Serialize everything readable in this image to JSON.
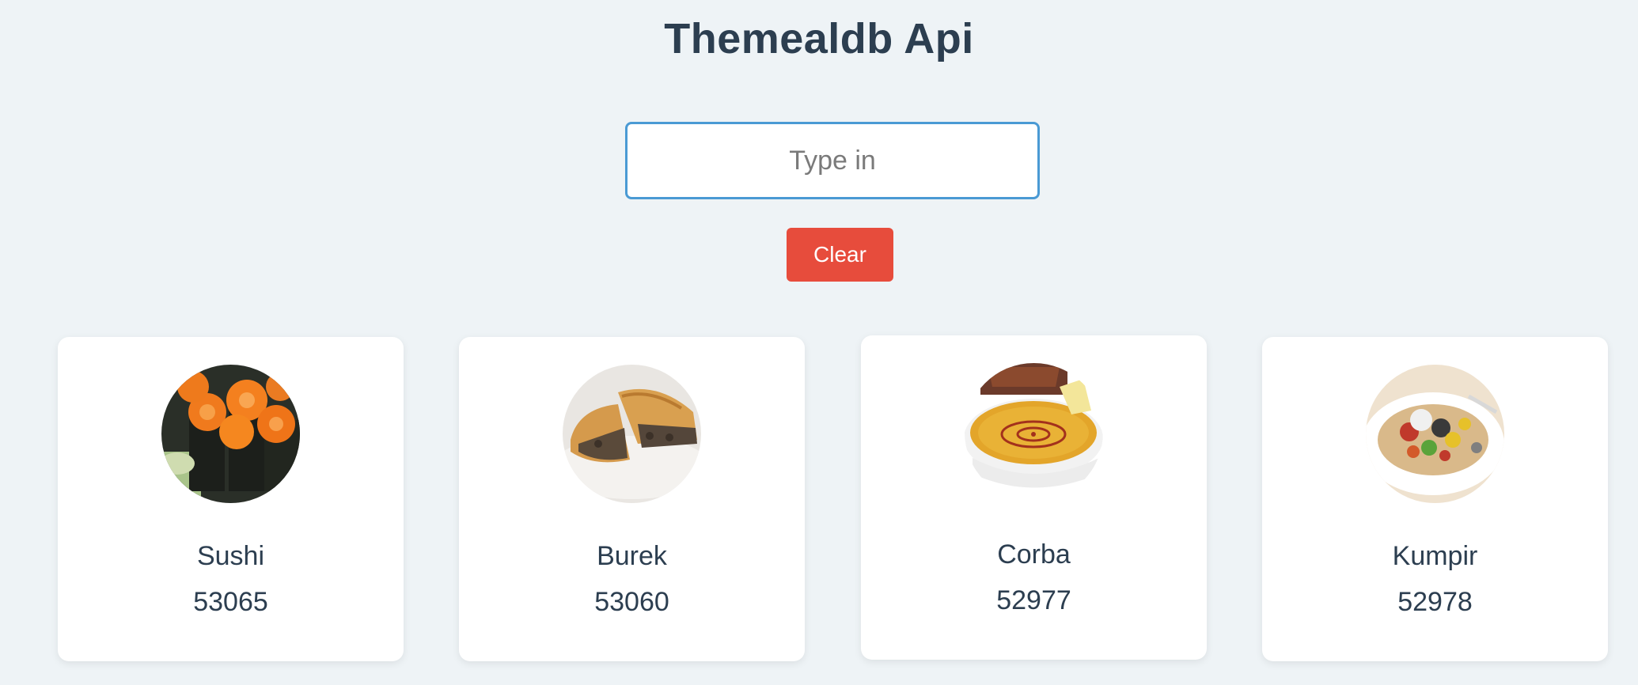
{
  "header": {
    "title": "Themealdb Api"
  },
  "search": {
    "placeholder": "Type in",
    "value": ""
  },
  "clear_button": {
    "label": "Clear"
  },
  "meals": [
    {
      "name": "Sushi",
      "id": "53065",
      "image": "sushi-photo"
    },
    {
      "name": "Burek",
      "id": "53060",
      "image": "burek-photo"
    },
    {
      "name": "Corba",
      "id": "52977",
      "image": "corba-soup-photo"
    },
    {
      "name": "Kumpir",
      "id": "52978",
      "image": "kumpir-photo"
    }
  ],
  "colors": {
    "background": "#eef3f6",
    "title": "#2c3e50",
    "input_border": "#4a9ad4",
    "clear_button": "#e74c3c",
    "card": "#ffffff"
  }
}
